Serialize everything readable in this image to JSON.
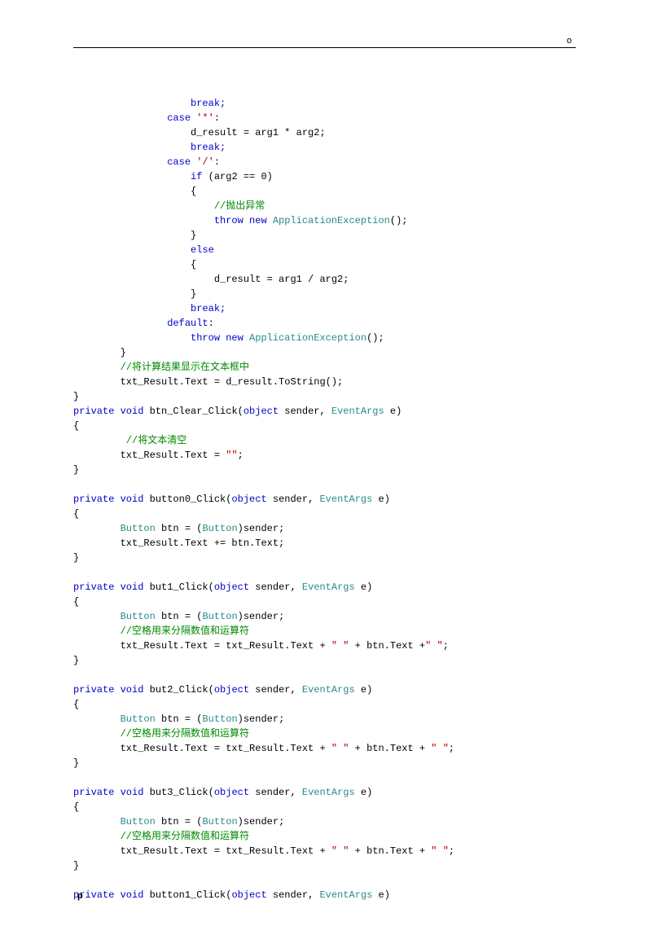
{
  "header": {
    "mark": "o"
  },
  "footer": {
    "mark": "p"
  },
  "code": {
    "l1": "                    break;",
    "l2_a": "                case ",
    "l2_b": "'*'",
    "l2_c": ":",
    "l3": "                    d_result = arg1 * arg2;",
    "l4": "                    break;",
    "l5_a": "                case ",
    "l5_b": "'/'",
    "l5_c": ":",
    "l6_a": "                    if",
    "l6_b": " (arg2 == 0)",
    "l7": "                    {",
    "l8": "                        //抛出异常",
    "l9_a": "                        throw new ",
    "l9_b": "ApplicationException",
    "l9_c": "();",
    "l10": "                    }",
    "l11": "                    else",
    "l12": "                    {",
    "l13": "                        d_result = arg1 / arg2;",
    "l14": "                    }",
    "l15": "                    break;",
    "l16_a": "                default",
    "l16_b": ":",
    "l17_a": "                    throw new ",
    "l17_b": "ApplicationException",
    "l17_c": "();",
    "l18": "        }",
    "l19": "        //将计算结果显示在文本框中",
    "l20": "        txt_Result.Text = d_result.ToString();",
    "l21": "}",
    "l22_a": "private void",
    "l22_b": " btn_Clear_Click(",
    "l22_c": "object",
    "l22_d": " sender, ",
    "l22_e": "EventArgs",
    "l22_f": " e)",
    "l23": "{",
    "l24": "         //将文本清空",
    "l25_a": "        txt_Result.Text = ",
    "l25_b": "\"\"",
    "l25_c": ";",
    "l26": "}",
    "l27": "",
    "l28_a": "private void",
    "l28_b": " button0_Click(",
    "l28_c": "object",
    "l28_d": " sender, ",
    "l28_e": "EventArgs",
    "l28_f": " e)",
    "l29": "{",
    "l30_a": "        Button",
    "l30_b": " btn = (",
    "l30_c": "Button",
    "l30_d": ")sender;",
    "l31": "        txt_Result.Text += btn.Text;",
    "l32": "}",
    "l33": "",
    "l34_a": "private void",
    "l34_b": " but1_Click(",
    "l34_c": "object",
    "l34_d": " sender, ",
    "l34_e": "EventArgs",
    "l34_f": " e)",
    "l35": "{",
    "l36_a": "        Button",
    "l36_b": " btn = (",
    "l36_c": "Button",
    "l36_d": ")sender;",
    "l37": "        //空格用来分隔数值和运算符",
    "l38_a": "        txt_Result.Text = txt_Result.Text + ",
    "l38_b": "\" \"",
    "l38_c": " + btn.Text +",
    "l38_d": "\" \"",
    "l38_e": ";",
    "l39": "}",
    "l40": "",
    "l41_a": "private void",
    "l41_b": " but2_Click(",
    "l41_c": "object",
    "l41_d": " sender, ",
    "l41_e": "EventArgs",
    "l41_f": " e)",
    "l42": "{",
    "l43_a": "        Button",
    "l43_b": " btn = (",
    "l43_c": "Button",
    "l43_d": ")sender;",
    "l44": "        //空格用来分隔数值和运算符",
    "l45_a": "        txt_Result.Text = txt_Result.Text + ",
    "l45_b": "\" \"",
    "l45_c": " + btn.Text + ",
    "l45_d": "\" \"",
    "l45_e": ";",
    "l46": "}",
    "l47": "",
    "l48_a": "private void",
    "l48_b": " but3_Click(",
    "l48_c": "object",
    "l48_d": " sender, ",
    "l48_e": "EventArgs",
    "l48_f": " e)",
    "l49": "{",
    "l50_a": "        Button",
    "l50_b": " btn = (",
    "l50_c": "Button",
    "l50_d": ")sender;",
    "l51": "        //空格用来分隔数值和运算符",
    "l52_a": "        txt_Result.Text = txt_Result.Text + ",
    "l52_b": "\" \"",
    "l52_c": " + btn.Text + ",
    "l52_d": "\" \"",
    "l52_e": ";",
    "l53": "}",
    "l54": "",
    "l55_a": "private void",
    "l55_b": " button1_Click(",
    "l55_c": "object",
    "l55_d": " sender, ",
    "l55_e": "EventArgs",
    "l55_f": " e)"
  }
}
